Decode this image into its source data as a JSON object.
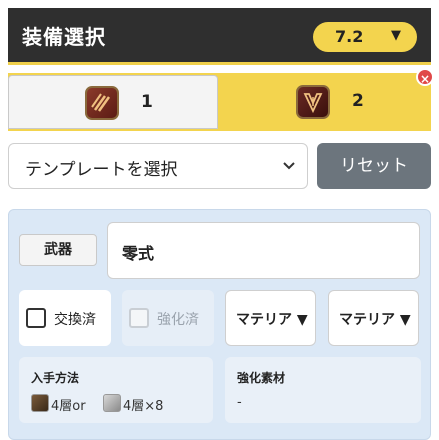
{
  "header": {
    "title": "装備選択",
    "version": "7.2"
  },
  "tabs": [
    {
      "number": "1",
      "icon": "bard-icon"
    },
    {
      "number": "2",
      "icon": "dark-knight-icon"
    }
  ],
  "template_select": {
    "value": "テンプレートを選択"
  },
  "reset_button": {
    "label": "リセット"
  },
  "slot": {
    "slot_label": "武器",
    "item_name": "零式",
    "exchanged_label": "交換済",
    "exchanged_checked": false,
    "enhanced_label": "強化済",
    "enhanced_checked": false,
    "enhanced_disabled": true,
    "materia_1": "マテリア ▼",
    "materia_2": "マテリア ▼",
    "acquisition_heading": "入手方法",
    "acquisition_1": "4層or",
    "acquisition_2": "4層×8",
    "enhance_heading": "強化素材",
    "enhance_value": "-"
  },
  "colors": {
    "accent": "#f3d44e",
    "header_bg": "#2f2f2f",
    "panel_bg": "#dbe8f6",
    "reset_bg": "#6c757d",
    "close_red": "#e04848"
  }
}
